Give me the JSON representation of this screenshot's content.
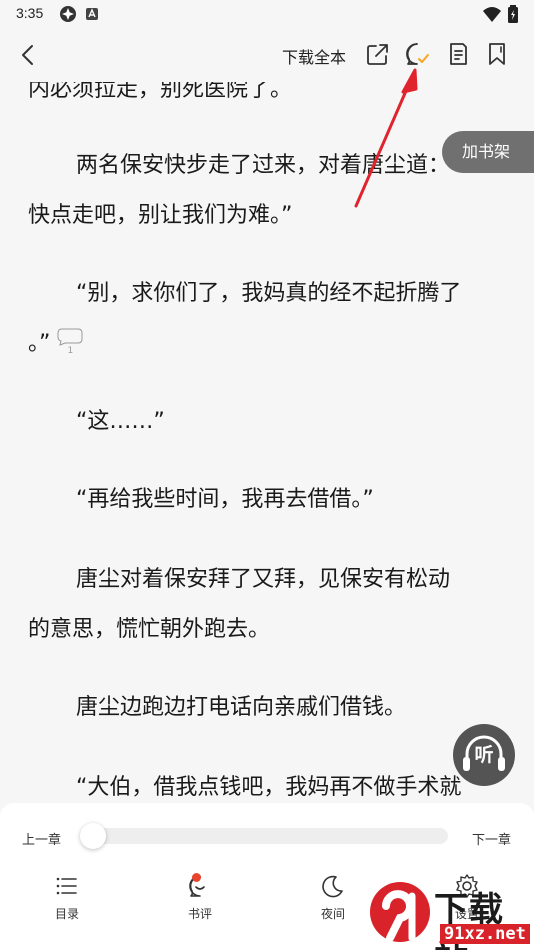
{
  "status": {
    "time": "3:35"
  },
  "toolbar": {
    "download_label": "下载全本"
  },
  "reader": {
    "paragraphs": [
      "内必须拉走，别死医院了。",
      "两名保安快步走了过来，对着唐尘道：",
      "快点走吧，别让我们为难。”",
      "“别，求你们了，我妈真的经不起折腾了",
      "。”",
      "“这……”",
      "“再给我些时间，我再去借借。”",
      "唐尘对着保安拜了又拜，见保安有松动",
      "的意思，慌忙朝外跑去。",
      "唐尘边跑边打电话向亲戚们借钱。",
      "“大伯，借我点钱吧，我妈再不做手术就"
    ],
    "comment_count": "1"
  },
  "floating": {
    "bookshelf_label": "加书架",
    "listen_label": "听"
  },
  "bottom": {
    "prev_label": "上一章",
    "next_label": "下一章",
    "progress": 0,
    "nav": [
      {
        "label": "目录",
        "icon": "list-icon"
      },
      {
        "label": "书评",
        "icon": "comment-icon"
      },
      {
        "label": "夜间",
        "icon": "moon-icon"
      },
      {
        "label": "设置",
        "icon": "settings-icon"
      }
    ]
  },
  "watermark": {
    "brand": "下载站",
    "url": "91xz.net"
  },
  "colors": {
    "arrow": "#e0242e",
    "accent": "#f5a623",
    "badge": "#e8442e"
  }
}
